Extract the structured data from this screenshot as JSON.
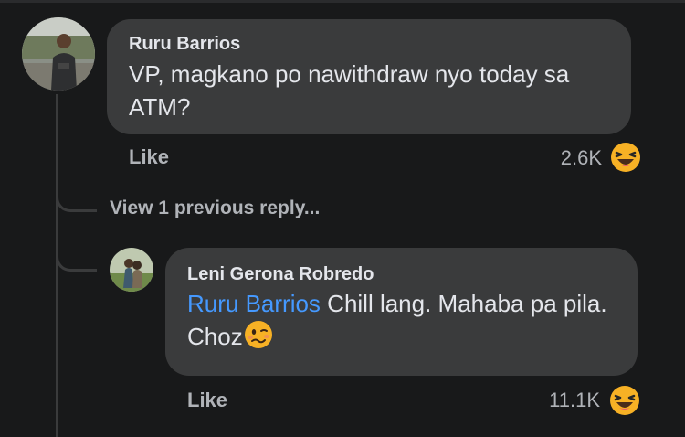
{
  "comment": {
    "author": "Ruru Barrios",
    "text": "VP, magkano po nawithdraw nyo today sa ATM?",
    "like_label": "Like",
    "reaction_count": "2.6K",
    "reaction_icon": "laughing-emoji-icon"
  },
  "view_previous": "View 1 previous reply...",
  "reply": {
    "author": "Leni Gerona Robredo",
    "mention": "Ruru Barrios",
    "text": " Chill lang. Mahaba pa pila. Choz",
    "inline_emoji": "woozy-face-emoji-icon",
    "like_label": "Like",
    "reaction_count": "11.1K",
    "reaction_icon": "laughing-emoji-icon"
  },
  "colors": {
    "background": "#18191a",
    "bubble": "#3a3b3c",
    "mention": "#4599ff",
    "secondary_text": "#b0b3b8",
    "reaction": "#f7b125"
  }
}
